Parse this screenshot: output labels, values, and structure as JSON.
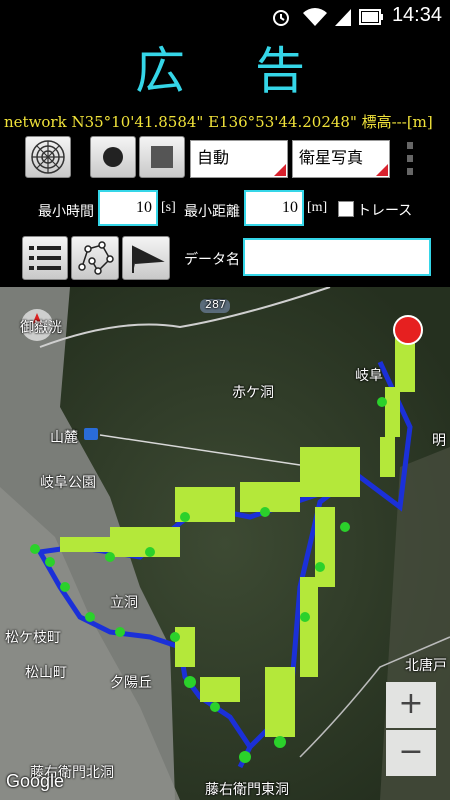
{
  "status": {
    "time": "14:34"
  },
  "ad": {
    "text": "広告"
  },
  "gps": {
    "text": "network N35°10'41.8584\" E136°53'44.20248\" 標高---[m]"
  },
  "controls": {
    "mode_select": "自動",
    "map_type_select": "衛星写真",
    "min_time_label": "最小時間",
    "min_time_value": "10",
    "min_time_unit": "[s]",
    "min_dist_label": "最小距離",
    "min_dist_value": "10",
    "min_dist_unit": "[m]",
    "trace_label": "トレース",
    "data_name_label": "データ名",
    "data_name_value": ""
  },
  "map": {
    "labels": {
      "road": "287",
      "akagahora": "赤ケ洞",
      "gifu": "岐阜",
      "akira": "明",
      "sanroku": "山麓",
      "gifukoen": "岐阜公園",
      "tatsuhora": "立洞",
      "matsugaeda": "松ケ枝町",
      "matsuyama": "松山町",
      "yuhigaoka": "夕陽丘",
      "kitakarato": "北唐戸",
      "toemon_higashi": "藤右衛門東洞",
      "toemon_kita": "藤右衛門北洞",
      "kanpu": "御嶽洸",
      "google": "Google"
    },
    "zoom_in": "+",
    "zoom_out": "−"
  },
  "colors": {
    "accent": "#35d6e8",
    "gps_text": "#f0e23a",
    "select_corner": "#d8222e"
  }
}
